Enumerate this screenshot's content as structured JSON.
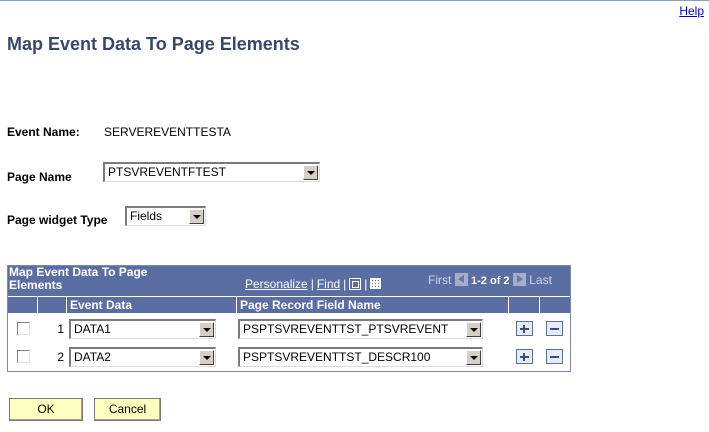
{
  "help_label": "Help",
  "page_title": "Map Event Data To Page Elements",
  "event_name": {
    "label": "Event Name:",
    "value": "SERVEREVENTTESTA"
  },
  "page_name": {
    "label": "Page Name",
    "value": "PTSVREVENTFTEST"
  },
  "widget_type": {
    "label": "Page widget Type",
    "value": "Fields"
  },
  "grid": {
    "title": "Map Event Data To Page Elements",
    "personalize": "Personalize",
    "separator": "|",
    "find": "Find",
    "first": "First",
    "range": "1-2 of 2",
    "last": "Last",
    "columns": {
      "event_data": "Event Data",
      "field_name": "Page Record Field Name"
    },
    "rows": [
      {
        "num": "1",
        "event_data": "DATA1",
        "field_name": "PSPTSVREVENTTST_PTSVREVENT",
        "selected": false
      },
      {
        "num": "2",
        "event_data": "DATA2",
        "field_name": "PSPTSVREVENTTST_DESCR100",
        "selected": false
      }
    ]
  },
  "buttons": {
    "ok": "OK",
    "cancel": "Cancel"
  },
  "colors": {
    "grid_header": "#5b6ea4",
    "title": "#38476e",
    "link": "#0000cc",
    "button_bg": "#ffffc0"
  }
}
